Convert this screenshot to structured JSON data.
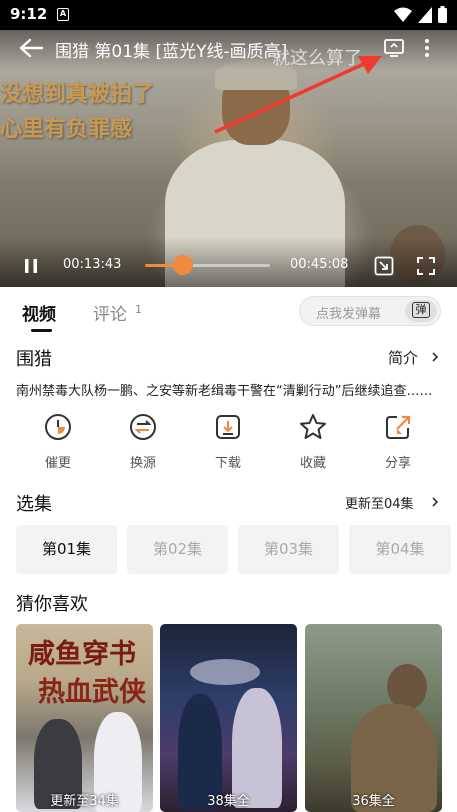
{
  "status_bar": {
    "time": "9:12",
    "sim_label": "A"
  },
  "player": {
    "title": "围猎 第01集 [蓝光Y线-画质高]",
    "subtitle_lines": [
      "没想到真被拍了",
      "心里有负罪感"
    ],
    "top_overlay_text": "就这么算了",
    "current_time": "00:13:43",
    "total_time": "00:45:08",
    "progress": 0.304,
    "accent_color": "#f08a3c"
  },
  "tabs": {
    "video_label": "视频",
    "comment_label": "评论",
    "comment_count": "1",
    "danmu_placeholder": "点我发弹幕",
    "danmu_button": "弹"
  },
  "show": {
    "title": "围猎",
    "intro_label": "简介",
    "description": "南州禁毒大队杨一鹏、之安等新老缉毒干警在“清剿行动”后继续追查……"
  },
  "actions": [
    {
      "label": "催更",
      "icon": "clock-icon"
    },
    {
      "label": "换源",
      "icon": "switch-source-icon"
    },
    {
      "label": "下载",
      "icon": "download-icon"
    },
    {
      "label": "收藏",
      "icon": "star-icon"
    },
    {
      "label": "分享",
      "icon": "share-icon"
    }
  ],
  "episodes": {
    "title": "选集",
    "update_label": "更新至04集",
    "items": [
      "第01集",
      "第02集",
      "第03集",
      "第04集"
    ],
    "active_index": 0
  },
  "recommend": {
    "title": "猜你喜欢",
    "items": [
      {
        "badge": "更新至34集",
        "poster_text": [
          "咸鱼穿书",
          "热血武侠"
        ]
      },
      {
        "badge": "38集全"
      },
      {
        "badge": "36集全"
      }
    ]
  }
}
